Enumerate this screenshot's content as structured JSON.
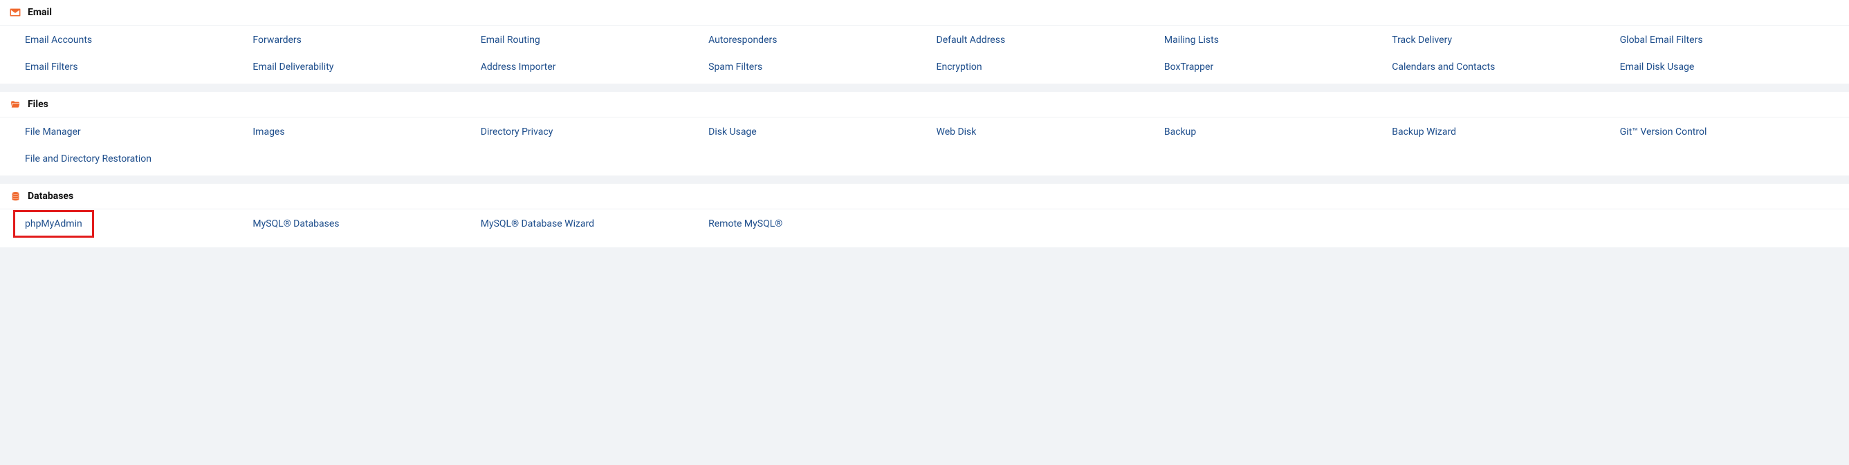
{
  "sections": [
    {
      "key": "email",
      "title": "Email",
      "icon": "envelope-icon",
      "items": [
        "Email Accounts",
        "Forwarders",
        "Email Routing",
        "Autoresponders",
        "Default Address",
        "Mailing Lists",
        "Track Delivery",
        "Global Email Filters",
        "Email Filters",
        "Email Deliverability",
        "Address Importer",
        "Spam Filters",
        "Encryption",
        "BoxTrapper",
        "Calendars and Contacts",
        "Email Disk Usage"
      ]
    },
    {
      "key": "files",
      "title": "Files",
      "icon": "folder-open-icon",
      "items": [
        "File Manager",
        "Images",
        "Directory Privacy",
        "Disk Usage",
        "Web Disk",
        "Backup",
        "Backup Wizard",
        "Git™ Version Control",
        "File and Directory Restoration"
      ]
    },
    {
      "key": "databases",
      "title": "Databases",
      "icon": "database-icon",
      "items": [
        "phpMyAdmin",
        "MySQL® Databases",
        "MySQL® Database Wizard",
        "Remote MySQL®"
      ],
      "highlighted_index": 0
    }
  ]
}
